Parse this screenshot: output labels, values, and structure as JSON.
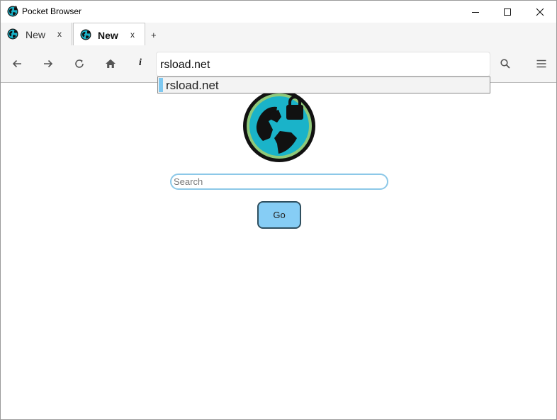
{
  "window": {
    "title": "Pocket Browser",
    "controls": [
      "minimize",
      "maximize",
      "close"
    ]
  },
  "tabs": [
    {
      "label": "New",
      "close": "x",
      "active": false
    },
    {
      "label": "New",
      "close": "x",
      "active": true
    }
  ],
  "new_tab_label": "+",
  "toolbar": {
    "back_icon": "arrow-left-icon",
    "forward_icon": "arrow-right-icon",
    "reload_icon": "reload-icon",
    "home_icon": "home-icon",
    "info_label": "i",
    "address_value": "rsload.net",
    "search_icon": "search-icon",
    "menu_icon": "hamburger-menu-icon"
  },
  "autocomplete": {
    "items": [
      "rsload.net"
    ]
  },
  "page": {
    "search_placeholder": "Search",
    "go_label": "Go"
  },
  "colors": {
    "accent": "#86cdf5",
    "logo_teal": "#1ab3c9",
    "logo_ring": "#8fc97a",
    "highlight": "#7ec8f0"
  }
}
